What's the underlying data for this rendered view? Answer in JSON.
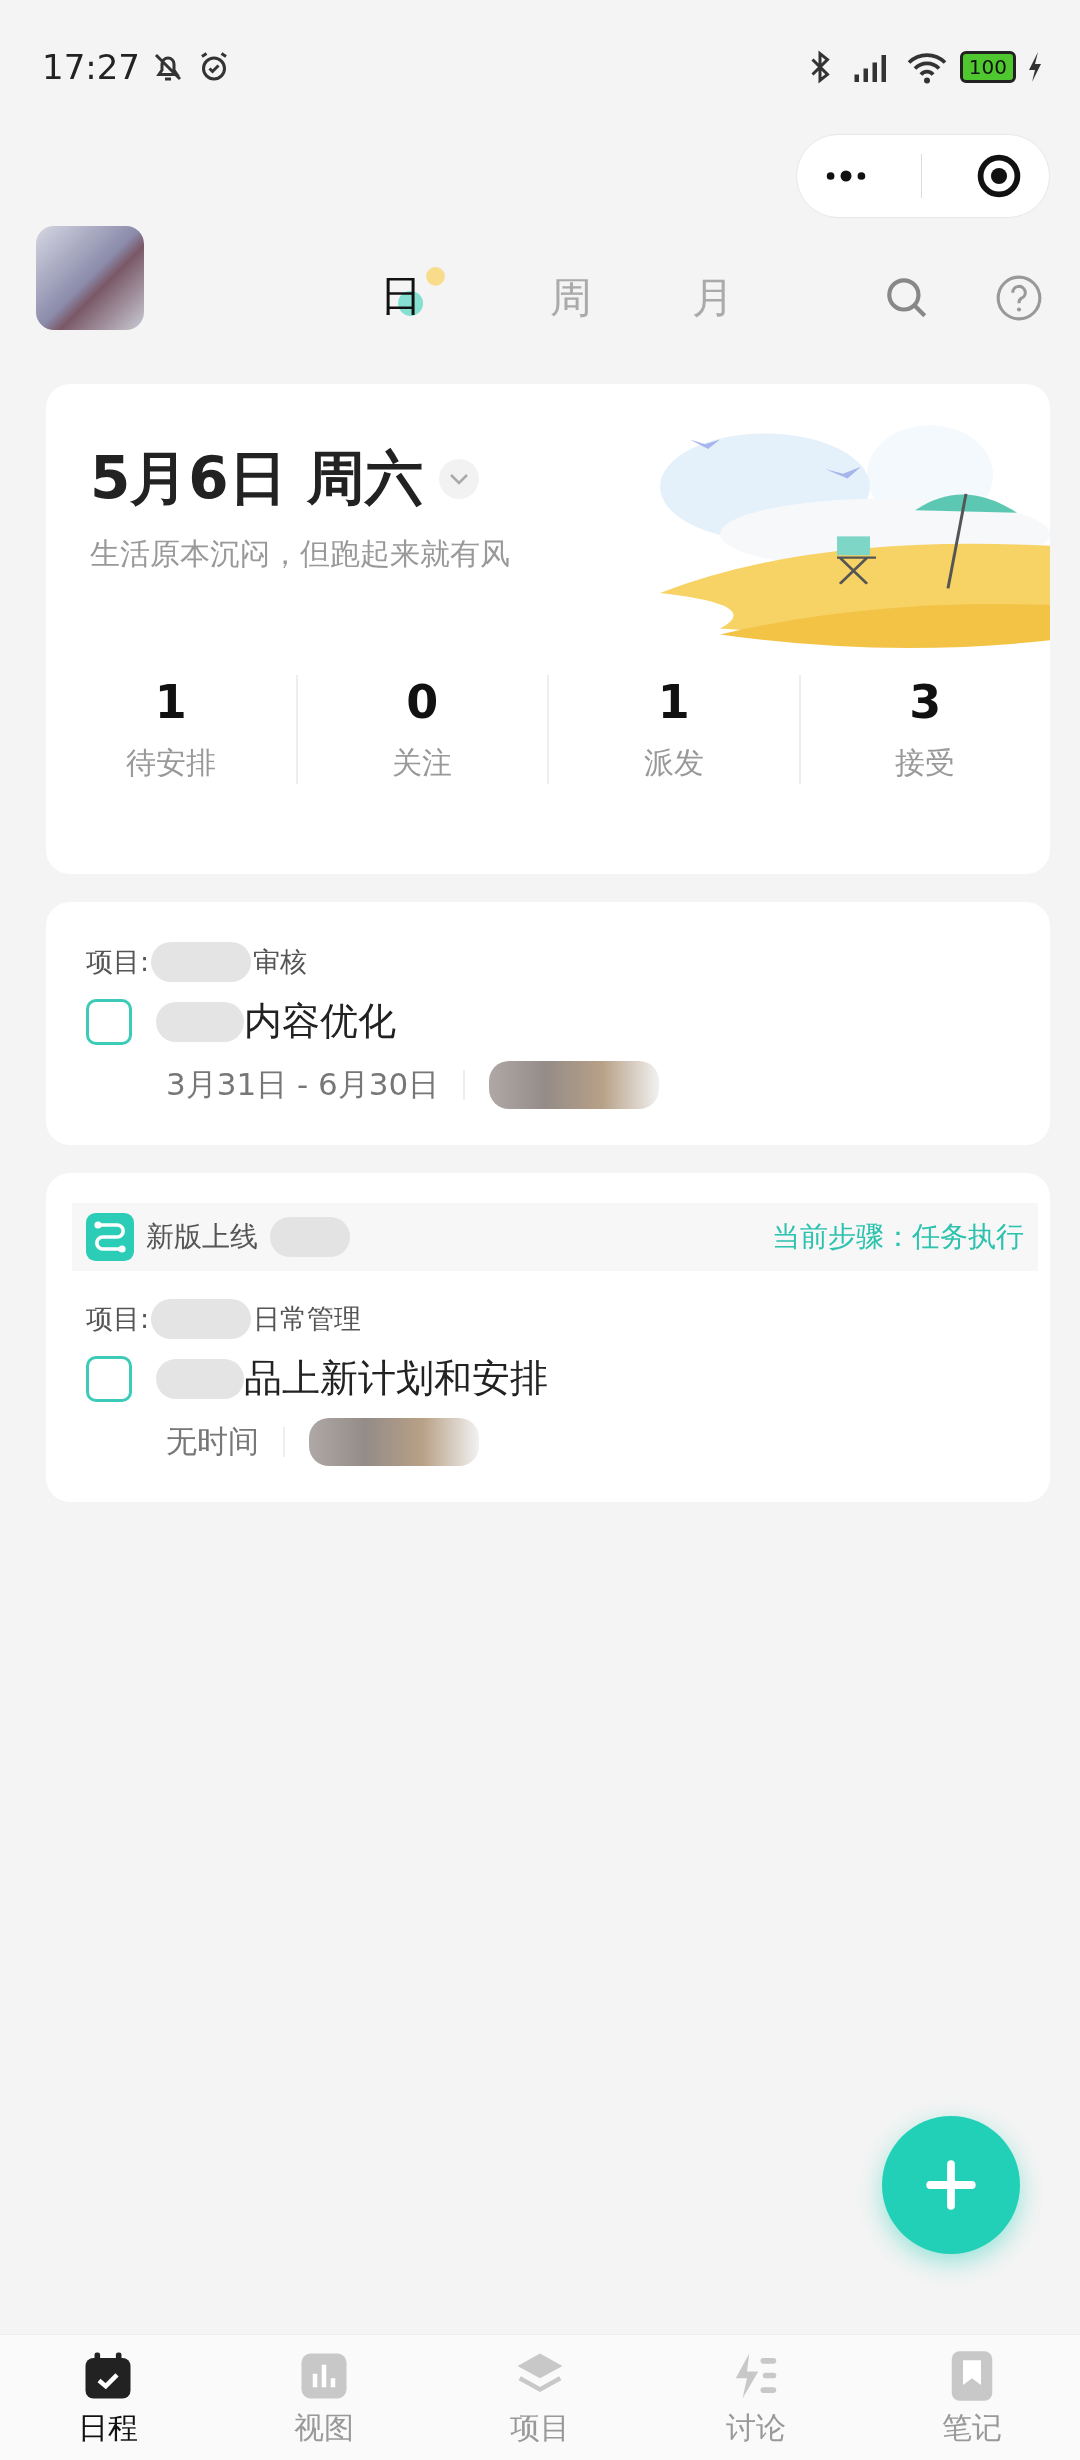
{
  "status_bar": {
    "time": "17:27",
    "battery": "100"
  },
  "view_tabs": [
    {
      "label": "日",
      "selected": true
    },
    {
      "label": "周",
      "selected": false
    },
    {
      "label": "月",
      "selected": false
    }
  ],
  "summary": {
    "date": "5月6日 周六",
    "motto": "生活原本沉闷，但跑起来就有风",
    "stats": [
      {
        "value": "1",
        "label": "待安排"
      },
      {
        "value": "0",
        "label": "关注"
      },
      {
        "value": "1",
        "label": "派发"
      },
      {
        "value": "3",
        "label": "接受"
      }
    ]
  },
  "tasks": [
    {
      "project_label": "项目:",
      "project_name": "审核",
      "title": "内容优化",
      "time": "3月31日 - 6月30日",
      "checked": false
    },
    {
      "workflow": {
        "name": "新版上线",
        "step": "当前步骤：任务执行"
      },
      "project_label": "项目:",
      "project_name": "日常管理",
      "title": "品上新计划和安排",
      "time": "无时间",
      "checked": false
    }
  ],
  "bottom_nav": [
    {
      "label": "日程",
      "kind": "calendar",
      "selected": true
    },
    {
      "label": "视图",
      "kind": "chart",
      "selected": false
    },
    {
      "label": "项目",
      "kind": "layers",
      "selected": false
    },
    {
      "label": "讨论",
      "kind": "discuss",
      "selected": false
    },
    {
      "label": "笔记",
      "kind": "note",
      "selected": false
    }
  ]
}
